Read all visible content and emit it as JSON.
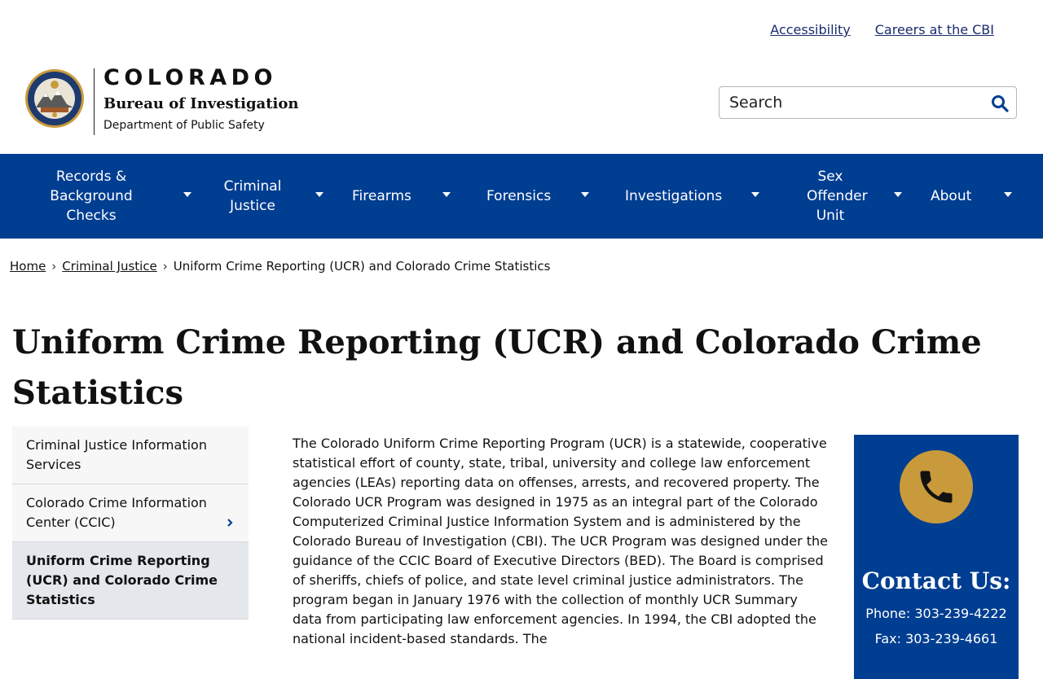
{
  "utility": {
    "accessibility": "Accessibility",
    "careers": "Careers at the CBI"
  },
  "header": {
    "brand": "COLORADO",
    "bureau": "Bureau of Investigation",
    "dept": "Department of Public Safety",
    "seal_icon": "cbi-seal-icon"
  },
  "search": {
    "placeholder": "Search"
  },
  "nav": {
    "items": [
      {
        "label": "Records & Background Checks"
      },
      {
        "label": "Criminal Justice"
      },
      {
        "label": "Firearms"
      },
      {
        "label": "Forensics"
      },
      {
        "label": "Investigations"
      },
      {
        "label": "Sex Offender Unit"
      },
      {
        "label": "About"
      }
    ]
  },
  "breadcrumb": {
    "home": "Home",
    "parent": "Criminal Justice",
    "current": "Uniform Crime Reporting (UCR) and Colorado Crime Statistics"
  },
  "page": {
    "title": "Uniform Crime Reporting (UCR) and Colorado Crime Statistics"
  },
  "sidenav": {
    "items": [
      {
        "label": "Criminal Justice Information Services"
      },
      {
        "label": "Colorado Crime Information Center (CCIC)"
      },
      {
        "label": "Uniform Crime Reporting (UCR) and Colorado Crime Statistics"
      }
    ]
  },
  "content": {
    "paragraph": "The Colorado Uniform Crime Reporting Program (UCR) is a statewide, cooperative statistical effort of county, state, tribal, university and college law enforcement agencies (LEAs) reporting data on offenses, arrests, and recovered property. The Colorado UCR Program was designed in 1975 as an integral part of the Colorado Computerized Criminal Justice Information System and is administered by the Colorado Bureau of Investigation (CBI). The UCR Program was designed under the guidance of the CCIC Board of Executive Directors (BED). The Board is comprised of sheriffs, chiefs of police, and state level criminal justice administrators. The program began in January 1976 with the collection of monthly UCR Summary data from participating law enforcement agencies. In 1994, the CBI adopted the national incident-based standards. The"
  },
  "contact": {
    "title": "Contact Us:",
    "phone": "Phone: 303-239-4222",
    "fax": "Fax: 303-239-4661"
  },
  "colors": {
    "nav_bg": "#003e92",
    "accent_gold": "#c99a3b",
    "link": "#1a2b6d"
  }
}
